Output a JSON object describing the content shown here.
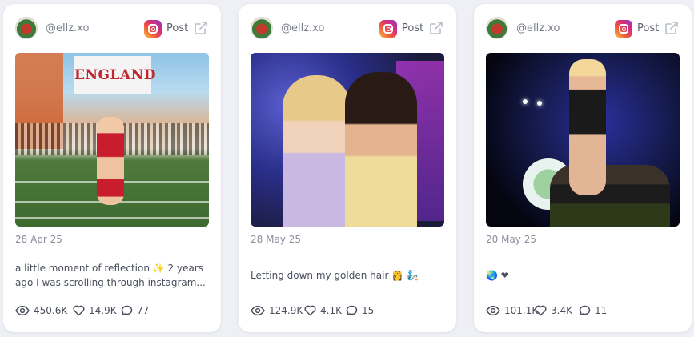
{
  "cards": [
    {
      "handle": "@ellz.xo",
      "post_label": "Post",
      "photo_sign": "ENGLAND",
      "date": "28 Apr 25",
      "caption_line1": "a little moment of reflection ✨ 2 years",
      "caption_line2": "ago I was scrolling through instagram...",
      "views": "450.6K",
      "likes": "14.9K",
      "comments": "77"
    },
    {
      "handle": "@ellz.xo",
      "post_label": "Post",
      "date": "28 May 25",
      "caption_line1": "Letting down my golden hair 👸 🧞",
      "views": "124.9K",
      "likes": "4.1K",
      "comments": "15"
    },
    {
      "handle": "@ellz.xo",
      "post_label": "Post",
      "date": "20 May 25",
      "caption_line1": "🌏 ❤",
      "views": "101.1K",
      "likes": "3.4K",
      "comments": "11"
    }
  ],
  "icons": {
    "platform": "instagram-icon",
    "external": "external-link-icon",
    "views": "eye-icon",
    "likes": "heart-icon",
    "comments": "comment-icon"
  },
  "colors": {
    "background": "#eef0f5",
    "card": "#ffffff",
    "muted_text": "#8a8f9c",
    "body_text": "#4a4f5c"
  }
}
